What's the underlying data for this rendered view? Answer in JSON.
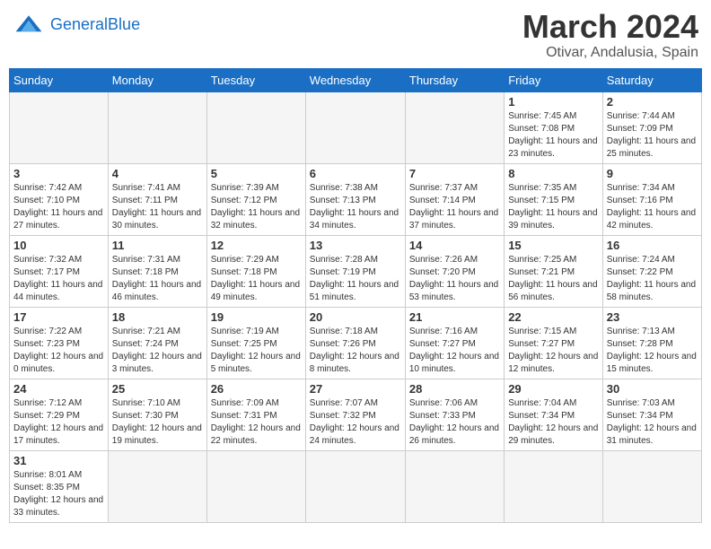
{
  "header": {
    "logo_general": "General",
    "logo_blue": "Blue",
    "title": "March 2024",
    "subtitle": "Otivar, Andalusia, Spain"
  },
  "days_of_week": [
    "Sunday",
    "Monday",
    "Tuesday",
    "Wednesday",
    "Thursday",
    "Friday",
    "Saturday"
  ],
  "weeks": [
    [
      {
        "day": "",
        "info": ""
      },
      {
        "day": "",
        "info": ""
      },
      {
        "day": "",
        "info": ""
      },
      {
        "day": "",
        "info": ""
      },
      {
        "day": "",
        "info": ""
      },
      {
        "day": "1",
        "info": "Sunrise: 7:45 AM\nSunset: 7:08 PM\nDaylight: 11 hours\nand 23 minutes."
      },
      {
        "day": "2",
        "info": "Sunrise: 7:44 AM\nSunset: 7:09 PM\nDaylight: 11 hours\nand 25 minutes."
      }
    ],
    [
      {
        "day": "3",
        "info": "Sunrise: 7:42 AM\nSunset: 7:10 PM\nDaylight: 11 hours\nand 27 minutes."
      },
      {
        "day": "4",
        "info": "Sunrise: 7:41 AM\nSunset: 7:11 PM\nDaylight: 11 hours\nand 30 minutes."
      },
      {
        "day": "5",
        "info": "Sunrise: 7:39 AM\nSunset: 7:12 PM\nDaylight: 11 hours\nand 32 minutes."
      },
      {
        "day": "6",
        "info": "Sunrise: 7:38 AM\nSunset: 7:13 PM\nDaylight: 11 hours\nand 34 minutes."
      },
      {
        "day": "7",
        "info": "Sunrise: 7:37 AM\nSunset: 7:14 PM\nDaylight: 11 hours\nand 37 minutes."
      },
      {
        "day": "8",
        "info": "Sunrise: 7:35 AM\nSunset: 7:15 PM\nDaylight: 11 hours\nand 39 minutes."
      },
      {
        "day": "9",
        "info": "Sunrise: 7:34 AM\nSunset: 7:16 PM\nDaylight: 11 hours\nand 42 minutes."
      }
    ],
    [
      {
        "day": "10",
        "info": "Sunrise: 7:32 AM\nSunset: 7:17 PM\nDaylight: 11 hours\nand 44 minutes."
      },
      {
        "day": "11",
        "info": "Sunrise: 7:31 AM\nSunset: 7:18 PM\nDaylight: 11 hours\nand 46 minutes."
      },
      {
        "day": "12",
        "info": "Sunrise: 7:29 AM\nSunset: 7:18 PM\nDaylight: 11 hours\nand 49 minutes."
      },
      {
        "day": "13",
        "info": "Sunrise: 7:28 AM\nSunset: 7:19 PM\nDaylight: 11 hours\nand 51 minutes."
      },
      {
        "day": "14",
        "info": "Sunrise: 7:26 AM\nSunset: 7:20 PM\nDaylight: 11 hours\nand 53 minutes."
      },
      {
        "day": "15",
        "info": "Sunrise: 7:25 AM\nSunset: 7:21 PM\nDaylight: 11 hours\nand 56 minutes."
      },
      {
        "day": "16",
        "info": "Sunrise: 7:24 AM\nSunset: 7:22 PM\nDaylight: 11 hours\nand 58 minutes."
      }
    ],
    [
      {
        "day": "17",
        "info": "Sunrise: 7:22 AM\nSunset: 7:23 PM\nDaylight: 12 hours\nand 0 minutes."
      },
      {
        "day": "18",
        "info": "Sunrise: 7:21 AM\nSunset: 7:24 PM\nDaylight: 12 hours\nand 3 minutes."
      },
      {
        "day": "19",
        "info": "Sunrise: 7:19 AM\nSunset: 7:25 PM\nDaylight: 12 hours\nand 5 minutes."
      },
      {
        "day": "20",
        "info": "Sunrise: 7:18 AM\nSunset: 7:26 PM\nDaylight: 12 hours\nand 8 minutes."
      },
      {
        "day": "21",
        "info": "Sunrise: 7:16 AM\nSunset: 7:27 PM\nDaylight: 12 hours\nand 10 minutes."
      },
      {
        "day": "22",
        "info": "Sunrise: 7:15 AM\nSunset: 7:27 PM\nDaylight: 12 hours\nand 12 minutes."
      },
      {
        "day": "23",
        "info": "Sunrise: 7:13 AM\nSunset: 7:28 PM\nDaylight: 12 hours\nand 15 minutes."
      }
    ],
    [
      {
        "day": "24",
        "info": "Sunrise: 7:12 AM\nSunset: 7:29 PM\nDaylight: 12 hours\nand 17 minutes."
      },
      {
        "day": "25",
        "info": "Sunrise: 7:10 AM\nSunset: 7:30 PM\nDaylight: 12 hours\nand 19 minutes."
      },
      {
        "day": "26",
        "info": "Sunrise: 7:09 AM\nSunset: 7:31 PM\nDaylight: 12 hours\nand 22 minutes."
      },
      {
        "day": "27",
        "info": "Sunrise: 7:07 AM\nSunset: 7:32 PM\nDaylight: 12 hours\nand 24 minutes."
      },
      {
        "day": "28",
        "info": "Sunrise: 7:06 AM\nSunset: 7:33 PM\nDaylight: 12 hours\nand 26 minutes."
      },
      {
        "day": "29",
        "info": "Sunrise: 7:04 AM\nSunset: 7:34 PM\nDaylight: 12 hours\nand 29 minutes."
      },
      {
        "day": "30",
        "info": "Sunrise: 7:03 AM\nSunset: 7:34 PM\nDaylight: 12 hours\nand 31 minutes."
      }
    ],
    [
      {
        "day": "31",
        "info": "Sunrise: 8:01 AM\nSunset: 8:35 PM\nDaylight: 12 hours\nand 33 minutes."
      },
      {
        "day": "",
        "info": ""
      },
      {
        "day": "",
        "info": ""
      },
      {
        "day": "",
        "info": ""
      },
      {
        "day": "",
        "info": ""
      },
      {
        "day": "",
        "info": ""
      },
      {
        "day": "",
        "info": ""
      }
    ]
  ]
}
